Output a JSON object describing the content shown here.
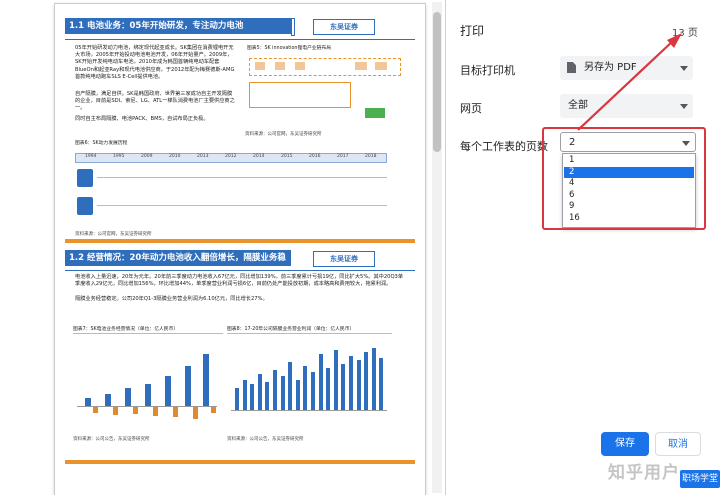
{
  "panel": {
    "title": "打印",
    "page_count": "13 页",
    "destination_label": "目标打印机",
    "destination_value": "另存为 PDF",
    "pages_label": "网页",
    "pages_value": "全部",
    "per_sheet_label": "每个工作表的页数",
    "per_sheet_value": "2",
    "per_sheet_options": [
      "1",
      "2",
      "4",
      "6",
      "9",
      "16"
    ],
    "per_sheet_selected_index": 1,
    "save_label": "保存",
    "cancel_label": "取消"
  },
  "watermark": {
    "text": "知乎用户",
    "badge": "职场学堂"
  },
  "doc": {
    "sec1_title": "1.1 电池业务：05年开始研发，专注动力电池",
    "logo": "东吴证券",
    "sec1_b1": "05年开始研发动力电池，绑定现代起亚成长。SK集团在消费锂电开无大市场，2005年开始投动电池电池开发，06年开始量产。2009年，SK开始开发纯电动车电池，2010年成为韩国首辆纯电动车配套BlueOn和起亚Ray和现代电池供应商，于2012年配为梅赛德斯-AMG首款纯电动跑车SLS E-Cell提供电池。",
    "sec1_b2": "自产隔膜，满足自供。SK是韩国政府、世界第三家成功自主开发隔膜的企业，目前是SDI、索尼、LG、ATL一梯队消费电池厂主要供应商之一。",
    "sec1_b3": "同时自主布局隔膜、电池PACK、BMS，自试布局正负极。",
    "fig5_caption": "图表5：SK innovation锂电产业链布局",
    "fig6_caption": "图表6：SK动力发展历程",
    "timeline_years": [
      "1994",
      "1995",
      "2009",
      "2010",
      "2013",
      "2012",
      "2014",
      "2015",
      "2016",
      "2017",
      "2018"
    ],
    "source1": "资料来源：公司官网，东吴证券研究所",
    "source2": "资料来源：公司官网，东吴证券研究所",
    "sec2_title": "1.2 经营情况：20年动力电池收入翻倍增长，隔膜业务稳定",
    "sec2_b1": "电池收入上量迅速，20年为元年。20年前三季度动力电池收入67亿元，同比增加139%，前三季度累计亏损19亿，同比扩大5%。其中20Q3单季度收入29亿元，同比增加156%，环比增加44%，单季度营业利润亏损6亿，目前仍处产能投放初期，成本略高和费用较大，拖累利润。",
    "sec2_b2": "隔膜业务经营稳定。公司20年Q1-3隔膜业务营业利润为6.10亿元，同比增长27%。",
    "fig7_caption": "图表7：SK电池业务经营情况（单位：亿人民币）",
    "fig8_caption": "图表8：17-20年公司隔膜业务营业利润（单位：亿人民币）",
    "source3": "资料来源：公司公告，东吴证券研究所",
    "source4": "资料来源：公司公告，东吴证券研究所"
  },
  "colors": {
    "accent": "#1a73e8",
    "highlight_red": "#d9363e",
    "doc_blue": "#2f6ebd",
    "doc_orange": "#e8932c"
  }
}
